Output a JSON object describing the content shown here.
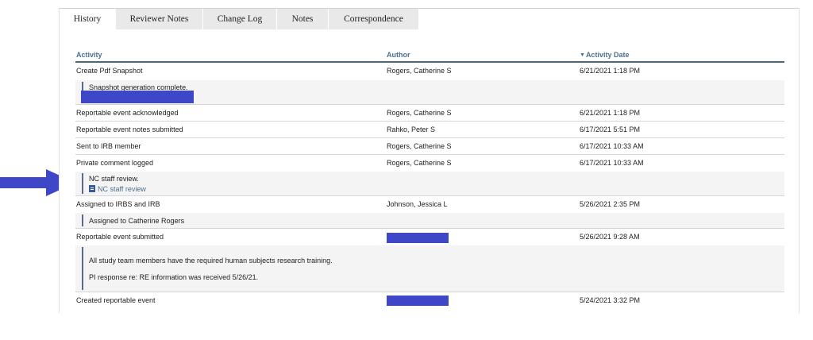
{
  "tabs": [
    {
      "label": "History",
      "active": true
    },
    {
      "label": "Reviewer Notes",
      "active": false
    },
    {
      "label": "Change Log",
      "active": false
    },
    {
      "label": "Notes",
      "active": false
    },
    {
      "label": "Correspondence",
      "active": false
    }
  ],
  "table": {
    "headers": {
      "activity": "Activity",
      "author": "Author",
      "date": "Activity Date"
    },
    "sort_icon": "caret-down-icon",
    "rows": [
      {
        "activity": "Create Pdf Snapshot",
        "author": "Rogers, Catherine S",
        "date": "6/21/2021 1:18 PM"
      },
      {
        "activity": "Reportable event acknowledged",
        "author": "Rogers, Catherine S",
        "date": "6/21/2021 1:18 PM"
      },
      {
        "activity": "Reportable event notes submitted",
        "author": "Rahko, Peter S",
        "date": "6/17/2021 5:51 PM"
      },
      {
        "activity": "Sent to IRB member",
        "author": "Rogers, Catherine S",
        "date": "6/17/2021 10:33 AM"
      },
      {
        "activity": "Private comment logged",
        "author": "Rogers, Catherine S",
        "date": "6/17/2021 10:33 AM"
      },
      {
        "activity": "Assigned to IRBS and IRB",
        "author": "Johnson, Jessica L",
        "date": "5/26/2021 2:35 PM"
      },
      {
        "activity": "Reportable event submitted",
        "author": "",
        "date": "5/26/2021 9:28 AM"
      },
      {
        "activity": "Created reportable event",
        "author": "",
        "date": "5/24/2021 3:32 PM"
      }
    ],
    "details": {
      "snapshot": "Snapshot generation complete.",
      "private_comment": "NC staff review.",
      "private_comment_link": "NC staff review",
      "assigned": "Assigned to Catherine Rogers",
      "submitted_line1": "All study team members have the required human subjects research training.",
      "submitted_line2": "PI response re: RE information was received 5/26/21."
    }
  },
  "colors": {
    "header_text": "#4d6f8c",
    "header_rule": "#4a6a83",
    "redaction": "#3f47c9",
    "arrow": "#3f47c9"
  }
}
